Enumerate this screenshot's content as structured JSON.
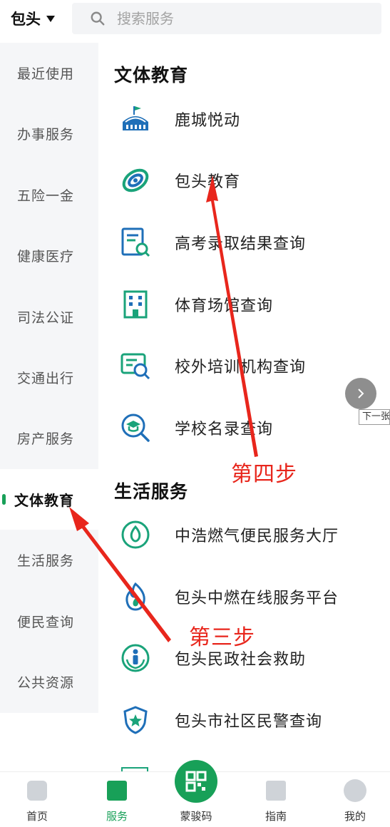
{
  "header": {
    "city": "包头",
    "search_placeholder": "搜索服务"
  },
  "sidebar": {
    "items": [
      {
        "label": "最近使用"
      },
      {
        "label": "办事服务"
      },
      {
        "label": "五险一金"
      },
      {
        "label": "健康医疗"
      },
      {
        "label": "司法公证"
      },
      {
        "label": "交通出行"
      },
      {
        "label": "房产服务"
      },
      {
        "label": "文体教育",
        "active": true
      },
      {
        "label": "生活服务"
      },
      {
        "label": "便民查询"
      },
      {
        "label": "公共资源"
      }
    ]
  },
  "main": {
    "sections": [
      {
        "title": "文体教育",
        "items": [
          {
            "label": "鹿城悦动",
            "icon": "stadium-icon"
          },
          {
            "label": "包头教育",
            "icon": "education-swirl-icon"
          },
          {
            "label": "高考录取结果查询",
            "icon": "document-search-icon"
          },
          {
            "label": "体育场馆查询",
            "icon": "building-icon"
          },
          {
            "label": "校外培训机构查询",
            "icon": "certificate-search-icon"
          },
          {
            "label": "学校名录查询",
            "icon": "graduation-search-icon"
          }
        ]
      },
      {
        "title": "生活服务",
        "items": [
          {
            "label": "中浩燃气便民服务大厅",
            "icon": "gas-flame-icon"
          },
          {
            "label": "包头中燃在线服务平台",
            "icon": "fire-icon"
          },
          {
            "label": "包头民政社会救助",
            "icon": "civil-affairs-icon"
          },
          {
            "label": "包头市社区民警查询",
            "icon": "police-badge-icon"
          }
        ]
      }
    ]
  },
  "annotations": {
    "step4": "第四步",
    "step3": "第三步",
    "color": "#e8261c"
  },
  "next_button": {
    "tooltip": "下一张"
  },
  "tabbar": {
    "items": [
      {
        "label": "首页"
      },
      {
        "label": "服务",
        "active": true
      },
      {
        "label": "蒙骏码"
      },
      {
        "label": "指南"
      },
      {
        "label": "我的"
      }
    ]
  },
  "colors": {
    "accent": "#18a058",
    "icon_blue": "#1f6fb8",
    "icon_green": "#1aa37a",
    "sidebar_bg": "#f5f6f8"
  }
}
